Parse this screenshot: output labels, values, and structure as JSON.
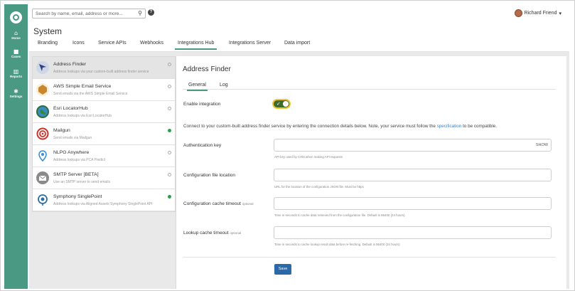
{
  "nav": {
    "items": [
      {
        "label": "Home",
        "icon": "home-icon",
        "glyph": "⌂"
      },
      {
        "label": "Cases",
        "icon": "cases-icon",
        "glyph": "■"
      },
      {
        "label": "Reports",
        "icon": "reports-icon",
        "glyph": "▥"
      },
      {
        "label": "Settings",
        "icon": "gear-icon",
        "glyph": "✱"
      }
    ]
  },
  "topbar": {
    "search_placeholder": "Search by name, email, address or more...",
    "help_glyph": "?",
    "user_name": "Richard Friend",
    "user_caret": "▾"
  },
  "page": {
    "title": "System",
    "tabs": [
      "Branding",
      "Icons",
      "Service APIs",
      "Webhooks",
      "Integrations Hub",
      "Integrations Server",
      "Data import"
    ],
    "active_tab": "Integrations Hub"
  },
  "integrations": [
    {
      "title": "Address Finder",
      "subtitle": "Address lookups via your custom-built address finder service",
      "status": "settings",
      "icon_color": "#2f3f86",
      "selected": true
    },
    {
      "title": "AWS Simple Email Service",
      "subtitle": "Send emails via the AWS Simple Email Service",
      "status": "settings",
      "icon_color": "#c9862b"
    },
    {
      "title": "Esri LocatorHub",
      "subtitle": "Address lookups via Esri LocatorHub",
      "status": "settings",
      "icon_color": "#2a6f3a"
    },
    {
      "title": "Mailgun",
      "subtitle": "Send emails via Mailgun",
      "status": "enabled",
      "icon_color": "#c8342b"
    },
    {
      "title": "NLPG Anywhere",
      "subtitle": "Address lookups via PCA Predict",
      "status": "settings",
      "icon_color": "#3a8fd0"
    },
    {
      "title": "SMTP Server [BETA]",
      "subtitle": "Use an SMTP server to send emails",
      "status": "settings",
      "icon_color": "#8a8a8a"
    },
    {
      "title": "Symphony SinglePoint",
      "subtitle": "Address lookups via Aligned Assets Symphony SinglePoint API",
      "status": "enabled",
      "icon_color": "#2d6ea6"
    }
  ],
  "panel": {
    "title": "Address Finder",
    "tabs": [
      "General",
      "Log"
    ],
    "active_tab": "General",
    "enable_label": "Enable integration",
    "enabled": true,
    "description_prefix": "Connect to your custom-built address finder service by entering the connection details below. Note, your service must follow the",
    "description_link": "specification",
    "description_suffix": "to be compatible.",
    "fields": [
      {
        "label": "Authentication key",
        "optional": "",
        "value": "",
        "action": "SHOW",
        "hint": "API key used by CXM when making API requests"
      },
      {
        "label": "Configuration file location",
        "optional": "",
        "value": "",
        "action": "",
        "hint": "URL for the location of the configuration JSON file. Must be https"
      },
      {
        "label": "Configuration cache timeout",
        "optional": "optional",
        "value": "",
        "action": "",
        "hint": "Time in seconds to cache data retrieved from the configuration file. Default is 86400 (24 hours)"
      },
      {
        "label": "Lookup cache timeout",
        "optional": "optional",
        "value": "",
        "action": "",
        "hint": "Time in seconds to cache lookup result data before re-fetching. Default is 86400 (24 hours)"
      }
    ],
    "save_label": "Save"
  },
  "colors": {
    "sidebar": "#4a9a83",
    "accent": "#4a9a83",
    "toggle_on": "#3f6b2a",
    "toggle_ring": "#f3c43a",
    "primary_button": "#2b6aa8",
    "link": "#3d7fc1",
    "status_enabled": "#2e9e4e"
  }
}
